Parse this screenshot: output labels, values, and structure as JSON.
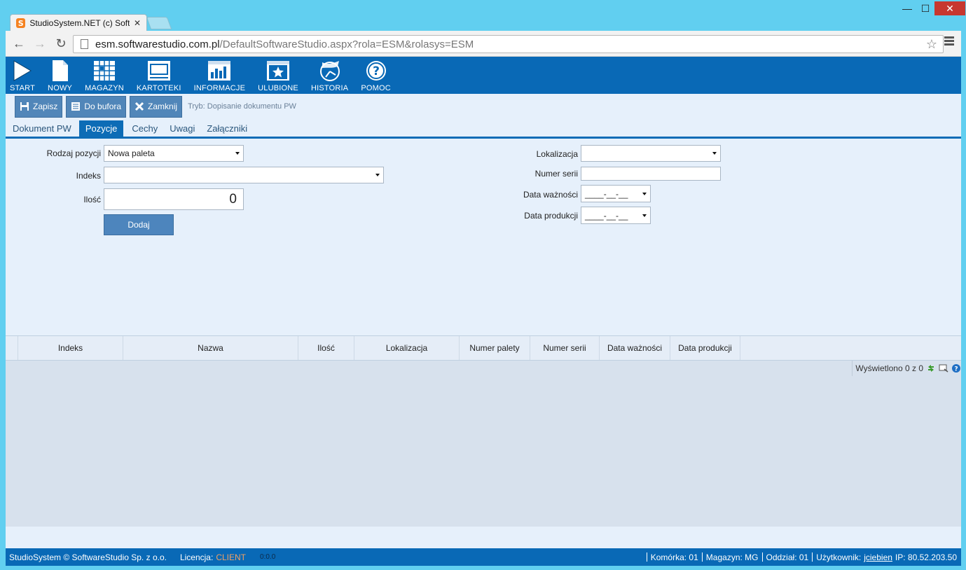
{
  "browser": {
    "tab_title": "StudioSystem.NET (c) Soft",
    "url_host": "esm.softwarestudio.com.pl",
    "url_rest": "/DefaultSoftwareStudio.aspx?rola=ESM&rolasys=ESM"
  },
  "mainbar": {
    "items": [
      {
        "label": "START",
        "icon": "play-icon"
      },
      {
        "label": "NOWY",
        "icon": "new-document-icon"
      },
      {
        "label": "MAGAZYN",
        "icon": "warehouse-grid-icon"
      },
      {
        "label": "KARTOTEKI",
        "icon": "card-file-icon"
      },
      {
        "label": "INFORMACJE",
        "icon": "bar-chart-icon"
      },
      {
        "label": "ULUBIONE",
        "icon": "star-icon"
      },
      {
        "label": "HISTORIA",
        "icon": "history-icon"
      },
      {
        "label": "POMOC",
        "icon": "help-icon"
      }
    ]
  },
  "actions": {
    "save": "Zapisz",
    "buffer": "Do bufora",
    "close": "Zamknij",
    "mode": "Tryb: Dopisanie dokumentu PW"
  },
  "tabs": [
    "Dokument PW",
    "Pozycje",
    "Cechy",
    "Uwagi",
    "Załączniki"
  ],
  "form": {
    "rodzaj_label": "Rodzaj pozycji",
    "rodzaj_value": "Nowa paleta",
    "indeks_label": "Indeks",
    "indeks_value": "",
    "ilosc_label": "Ilość",
    "ilosc_value": "0",
    "add_button": "Dodaj",
    "lokalizacja_label": "Lokalizacja",
    "lokalizacja_value": "",
    "numer_serii_label": "Numer serii",
    "numer_serii_value": "",
    "data_waznosci_label": "Data ważności",
    "data_waznosci_value": "____-__-__",
    "data_produkcji_label": "Data produkcji",
    "data_produkcji_value": "____-__-__"
  },
  "grid": {
    "columns": [
      "Indeks",
      "Nazwa",
      "Ilość",
      "Lokalizacja",
      "Numer palety",
      "Numer serii",
      "Data ważności",
      "Data produkcji"
    ],
    "pager_text": "Wyświetlono 0 z 0"
  },
  "status": {
    "copyright": "StudioSystem © SoftwareStudio Sp. z o.o.",
    "license_label": "Licencja:",
    "license_value": "CLIENT",
    "timer": "0:0.0",
    "komorka": "Komórka: 01",
    "magazyn": "Magazyn: MG",
    "oddzial": "Oddział: 01",
    "user_label": "Użytkownik:",
    "user": "jciebien",
    "ip": "IP: 80.52.203.50"
  },
  "colors": {
    "brand_blue": "#0969b6",
    "button_blue": "#5186b9",
    "license_orange": "#f0a063"
  }
}
